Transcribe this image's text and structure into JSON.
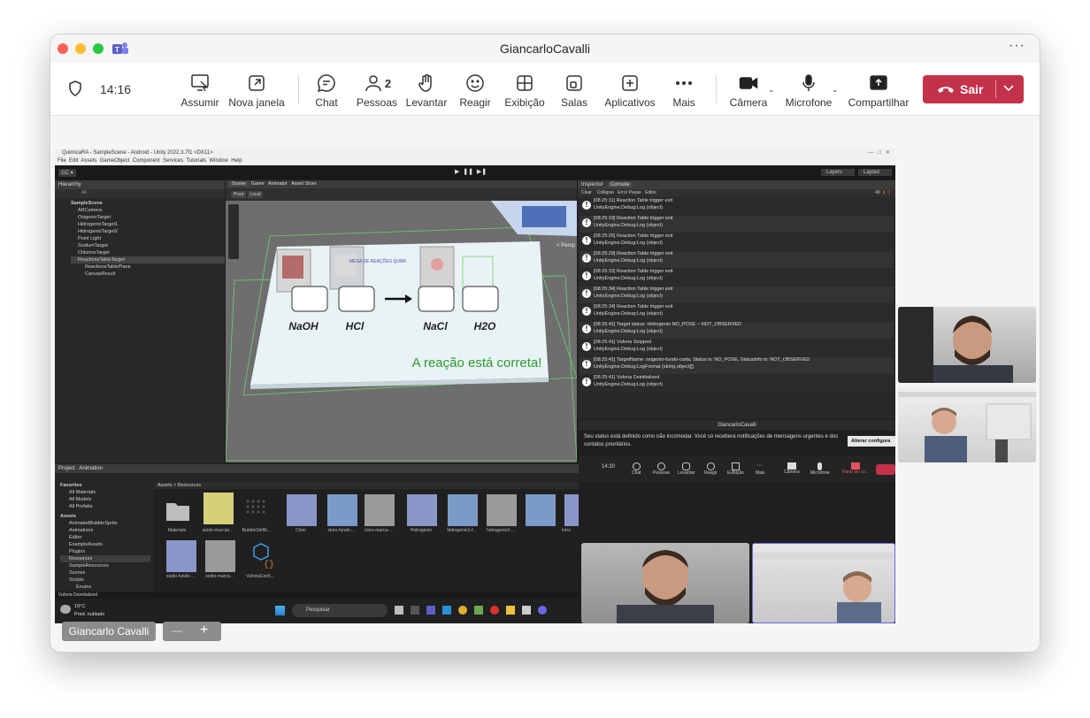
{
  "window": {
    "title": "GiancarloCavalli",
    "more": "···"
  },
  "toolbar": {
    "time": "14:16",
    "assumir": "Assumir",
    "nova_janela": "Nova janela",
    "chat": "Chat",
    "pessoas": "Pessoas",
    "pessoas_count": "2",
    "levantar": "Levantar",
    "reagir": "Reagir",
    "exibicao": "Exibição",
    "salas": "Salas",
    "aplicativos": "Aplicativos",
    "mais": "Mais",
    "camera": "Câmera",
    "microfone": "Microfone",
    "compartilhar": "Compartilhar",
    "sair": "Sair",
    "leave_color": "#c4314b"
  },
  "unity": {
    "title": "QuimicaRA - SampleScene - Android - Unity 2022.3.7f1 <DX11>",
    "menu": [
      "File",
      "Edit",
      "Assets",
      "GameObject",
      "Component",
      "Services",
      "Tutorials",
      "Window",
      "Help"
    ],
    "account": "GC ▾",
    "layers": "Layers",
    "layout": "Layout",
    "hierarchy_tab": "Hierarchy",
    "hierarchy_search": "All",
    "hierarchy": [
      "SampleScene",
      "ARCamera",
      "OxigenioTarget",
      "HidrogenioTarget1",
      "HidrogenioTarget2",
      "Point Light",
      "SodiumTarget",
      "ChlorineTarget",
      "ReactionsTableTarget",
      "ReactionsTablePlane",
      "CanvasResult"
    ],
    "scene_tabs": [
      "Scene",
      "Game",
      "Animator",
      "Asset Store"
    ],
    "scene_pivot": "Pivot",
    "scene_local": "Local",
    "persp": "< Persp",
    "scene_table_header": "MESA DE REAÇÕES QUÍMI",
    "formula_labels": [
      "NaOH",
      "HCl",
      "NaCl",
      "H2O"
    ],
    "result_text": "A reação está correta!",
    "inspector_tab": "Inspector",
    "console_tab": "Console",
    "console_toolbar": [
      "Clear",
      "Collapse",
      "Error Pause",
      "Editor"
    ],
    "console_counts": [
      "49",
      "1",
      "0"
    ],
    "console": [
      {
        "t": "[08:25:11] Reaction Table trigger exit",
        "s": "UnityEngine.Debug:Log (object)"
      },
      {
        "t": "[08:25:19] Reaction Table trigger exit",
        "s": "UnityEngine.Debug:Log (object)"
      },
      {
        "t": "[08:25:26] Reaction Table trigger exit",
        "s": "UnityEngine.Debug:Log (object)"
      },
      {
        "t": "[08:25:29] Reaction Table trigger exit",
        "s": "UnityEngine.Debug:Log (object)"
      },
      {
        "t": "[08:25:33] Reaction Table trigger exit",
        "s": "UnityEngine.Debug:Log (object)"
      },
      {
        "t": "[08:25:34] Reaction Table trigger exit",
        "s": "UnityEngine.Debug:Log (object)"
      },
      {
        "t": "[08:25:34] Reaction Table trigger exit",
        "s": "UnityEngine.Debug:Log (object)"
      },
      {
        "t": "[08:25:41] Target status: Hidrogenio NO_POSE -- NOT_OBSERVED",
        "s": "UnityEngine.Debug:Log (object)"
      },
      {
        "t": "[08:25:41] Vuforia Stopped",
        "s": "UnityEngine.Debug:Log (object)"
      },
      {
        "t": "[08:25:41] TargetName: oxigenio-fundo-carta, Status is: NO_POSE, StatusInfo is: NOT_OBSERVED",
        "s": "UnityEngine.Debug:LogFormat (string,object[])"
      },
      {
        "t": "[08:25:41] Vuforia Deinitialized",
        "s": "UnityEngine.Debug:Log (object)"
      }
    ],
    "project_tabs": [
      "Project",
      "Animation"
    ],
    "favorites": "Favorites",
    "favorites_items": [
      "All Materials",
      "All Models",
      "All Prefabs"
    ],
    "assets_root": "Assets",
    "assets_folders": [
      "AnimatedBubbleSprite",
      "Animations",
      "Editor",
      "ExampleAssets",
      "Plugins",
      "Resources",
      "SampleResources",
      "Scenes",
      "Scripts",
      "Enums"
    ],
    "breadcrumb": "Assets > Resources",
    "asset_items": [
      "Materials",
      "acido-murciat...",
      "BubbleShift0...",
      "Cloro",
      "cloro-fundo-...",
      "cloro-marca-...",
      "Hidrogenio",
      "hidrogenio1-f...",
      "hidrogenio2-...",
      "Intro",
      "sodio-fundo-...",
      "sodio-marca...",
      "VuforiaConfi..."
    ],
    "status_bar": "Vuforia Deinitialized"
  },
  "teams_inner": {
    "title": "GiancarloCavalli",
    "notice": "Seu status está definido como não incomodar. Você só receberá notificações de mensagens urgentes e dos contatos prioritários.",
    "change_button": "Alterar configura",
    "time": "14:20",
    "buttons": [
      "Chat",
      "Pessoas",
      "Levantar",
      "Reagir",
      "Exibição",
      "Mais",
      "Câmera",
      "Microfone",
      "Parar de co..."
    ],
    "pessoas_count": "2"
  },
  "taskbar": {
    "temp": "19°C",
    "weather": "Pred. nublado",
    "search": "Pesquisar"
  },
  "stage": {
    "presenter_name": "Giancarlo Cavalli",
    "zoom_out": "—",
    "zoom_in": "+"
  }
}
